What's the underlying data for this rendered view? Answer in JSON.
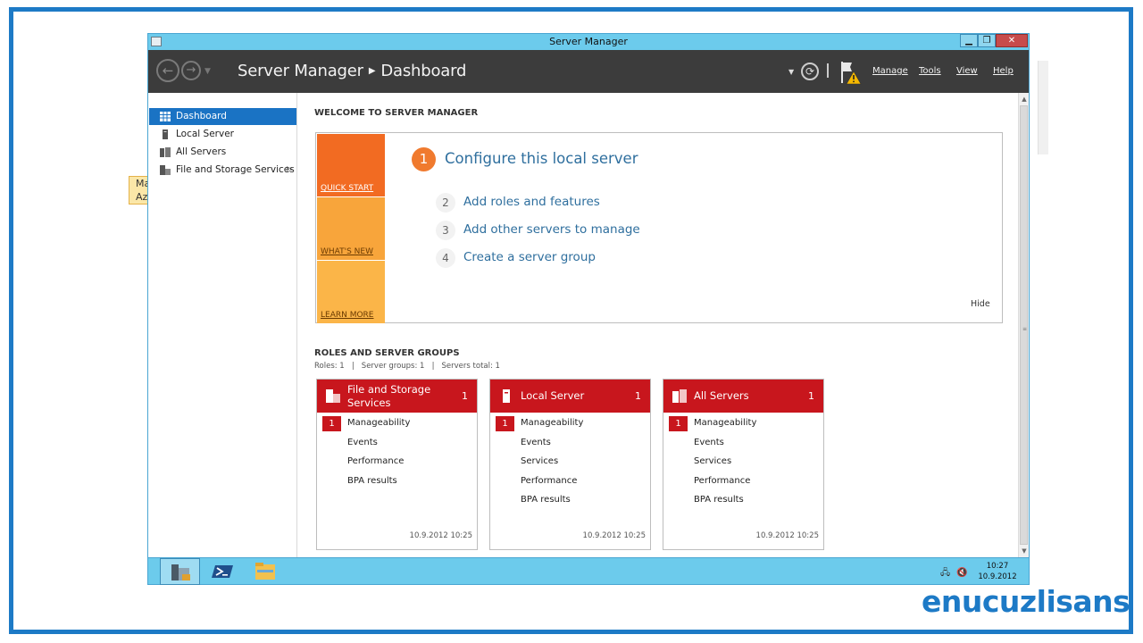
{
  "window": {
    "title": "Server Manager"
  },
  "ghost_tooltip": {
    "line1": "Ma",
    "line2": "Az"
  },
  "header": {
    "breadcrumb_app": "Server Manager",
    "breadcrumb_page": "Dashboard",
    "menus": [
      "Manage",
      "Tools",
      "View",
      "Help"
    ]
  },
  "sidebar": {
    "items": [
      {
        "label": "Dashboard",
        "icon": "dashboard-grid-icon",
        "active": true
      },
      {
        "label": "Local Server",
        "icon": "server-icon"
      },
      {
        "label": "All Servers",
        "icon": "servers-icon"
      },
      {
        "label": "File and Storage Services",
        "icon": "file-storage-icon",
        "has_submenu": true
      }
    ]
  },
  "welcome": {
    "title": "WELCOME TO SERVER MANAGER",
    "tiles": [
      "QUICK START",
      "WHAT'S NEW",
      "LEARN MORE"
    ],
    "main_step": {
      "num": "1",
      "label": "Configure this local server"
    },
    "steps": [
      {
        "num": "2",
        "label": "Add roles and features"
      },
      {
        "num": "3",
        "label": "Add other servers to manage"
      },
      {
        "num": "4",
        "label": "Create a server group"
      }
    ],
    "hide": "Hide"
  },
  "roles": {
    "title": "ROLES AND SERVER GROUPS",
    "stats": "Roles: 1   |   Server groups: 1   |   Servers total: 1",
    "tiles": [
      {
        "title": "File and Storage Services",
        "count": "1",
        "badge": "1",
        "rows": [
          "Manageability",
          "Events",
          "Performance",
          "BPA results"
        ],
        "timestamp": "10.9.2012 10:25"
      },
      {
        "title": "Local Server",
        "count": "1",
        "badge": "1",
        "rows": [
          "Manageability",
          "Events",
          "Services",
          "Performance",
          "BPA results"
        ],
        "timestamp": "10.9.2012 10:25"
      },
      {
        "title": "All Servers",
        "count": "1",
        "badge": "1",
        "rows": [
          "Manageability",
          "Events",
          "Services",
          "Performance",
          "BPA results"
        ],
        "timestamp": "10.9.2012 10:25"
      }
    ]
  },
  "taskbar": {
    "apps": [
      "server-manager-icon",
      "powershell-icon",
      "file-explorer-icon"
    ],
    "clock_time": "10:27",
    "clock_date": "10.9.2012"
  },
  "brand": {
    "logo_text": "enucuzlisans",
    "color": "#1d7ac6"
  },
  "colors": {
    "accent": "#1a73c4",
    "tile_red": "#c8161d",
    "quick_start": "#f26b22",
    "link": "#2f6f9e"
  }
}
